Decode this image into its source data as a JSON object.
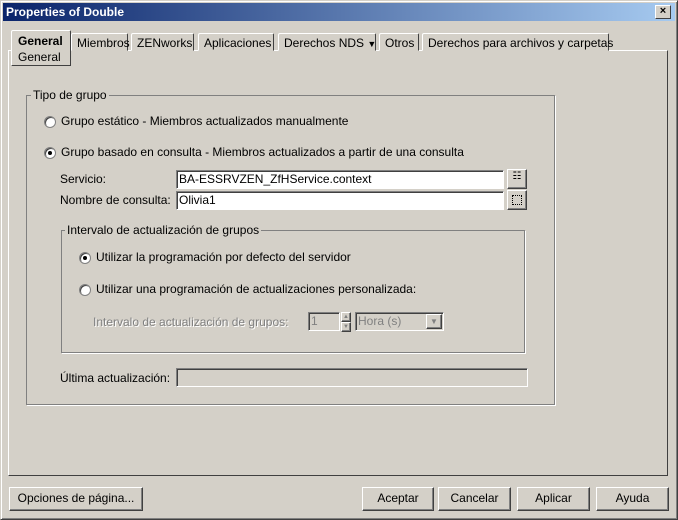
{
  "window": {
    "title": "Properties of Double",
    "close": "×"
  },
  "tabs": [
    {
      "label": "General",
      "sub": "General"
    },
    {
      "label": "Miembros"
    },
    {
      "label": "ZENworks"
    },
    {
      "label": "Aplicaciones"
    },
    {
      "label": "Derechos NDS",
      "dropdown": "▼"
    },
    {
      "label": "Otros"
    },
    {
      "label": "Derechos para archivos y carpetas"
    }
  ],
  "group_type": {
    "legend": "Tipo de grupo",
    "static_radio": "Grupo estático - Miembros actualizados manualmente",
    "query_radio": "Grupo basado en consulta - Miembros actualizados a partir de una consulta",
    "service_label": "Servicio:",
    "service_value": "BA-ESSRVZEN_ZfHService.context",
    "query_name_label": "Nombre de consulta:",
    "query_name_value": "Olivia1",
    "interval": {
      "legend": "Intervalo de actualización de grupos",
      "default_radio": "Utilizar la programación por defecto del servidor",
      "custom_radio": "Utilizar una programación de actualizaciones personalizada:",
      "interval_label": "Intervalo de actualización de grupos:",
      "interval_value": "1",
      "unit": "Hora (s)"
    },
    "last_update_label": "Última actualización:",
    "last_update_value": ""
  },
  "buttons": {
    "page_options": "Opciones de página...",
    "ok": "Aceptar",
    "cancel": "Cancelar",
    "apply": "Aplicar",
    "help": "Ayuda"
  }
}
